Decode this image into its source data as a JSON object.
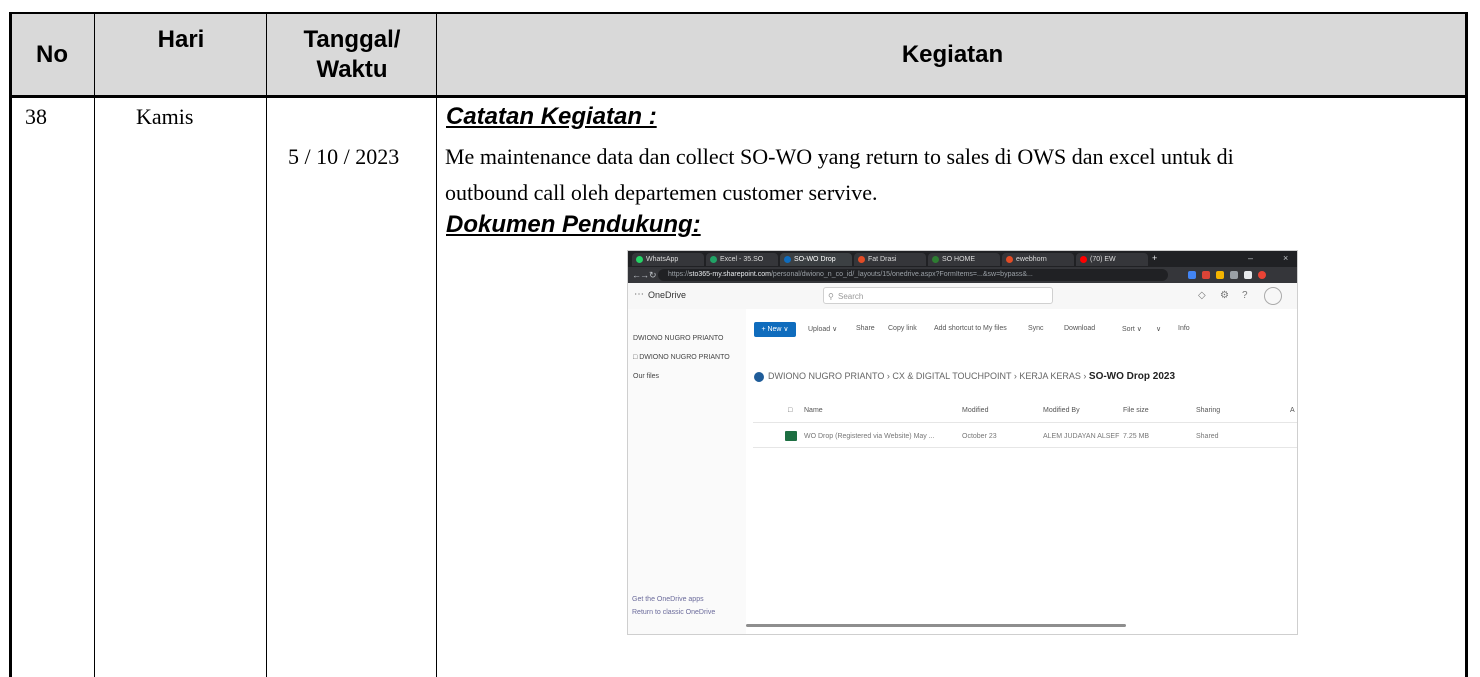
{
  "table": {
    "headers": {
      "no": "No",
      "hari": "Hari",
      "tanggal_line1": "Tanggal/",
      "tanggal_line2": "Waktu",
      "kegiatan": "Kegiatan"
    },
    "row": {
      "no": "38",
      "hari": "Kamis",
      "tanggal": "5 / 10 / 2023",
      "catatan_title": "Catatan Kegiatan :",
      "catatan_line1": "Me maintenance data dan collect SO-WO yang return to sales di OWS dan excel untuk  di",
      "catatan_line2": "outbound call oleh departemen customer servive.",
      "dokumen_title": "Dokumen Pendukung:"
    },
    "header_bg": "#d9d9d9"
  },
  "screenshot": {
    "tabs": [
      {
        "label": "WhatsApp",
        "icon": "whatsapp-icon",
        "color": "#25d366"
      },
      {
        "label": "Excel - 35.SO",
        "icon": "excel-icon",
        "color": "#21a366"
      },
      {
        "label": "SO-WO Drop",
        "icon": "onedrive-icon",
        "color": "#0f6cbd",
        "active": true
      },
      {
        "label": "Fat Drasi",
        "icon": "app-icon",
        "color": "#e34c26"
      },
      {
        "label": "SO HOME",
        "icon": "app-icon",
        "color": "#2e7d32"
      },
      {
        "label": "ewebhorn",
        "icon": "app-icon",
        "color": "#e34c26"
      },
      {
        "label": "(70) EW",
        "icon": "youtube-icon",
        "color": "#ff0000"
      }
    ],
    "url_prefix": "https://",
    "url_host": "sto365-my.sharepoint.com",
    "url_rest": "/personal/dwiono_n_co_id/_layouts/15/onedrive.aspx?FormItems=...&sw=bypass&...",
    "app_name": "OneDrive",
    "search_placeholder": "Search",
    "nav": {
      "user": "DWIONO NUGRO PRIANTO",
      "folder": "DWIONO NUGRO PRIANTO",
      "our_files": "Our files",
      "get_apps": "Get the OneDrive apps",
      "return_classic": "Return to classic OneDrive"
    },
    "commands": {
      "new": "+ New ∨",
      "upload": "Upload ∨",
      "share": "Share",
      "copy_link": "Copy link",
      "add_shortcut": "Add shortcut to My files",
      "sync": "Sync",
      "download": "Download",
      "sort": "Sort ∨",
      "view": "∨",
      "info": "Info"
    },
    "breadcrumb": {
      "p1": "DWIONO NUGRO PRIANTO",
      "p2": "CX & DIGITAL TOUCHPOINT",
      "p3": "KERJA KERAS",
      "current": "SO-WO Drop 2023"
    },
    "columns": [
      "Name",
      "Modified",
      "Modified By",
      "File size",
      "Sharing",
      "A"
    ],
    "file_row": {
      "name": "WO Drop (Registered via Website) May ...",
      "modified": "October 23",
      "modified_by": "ALEM JUDAYAN ALSEF",
      "size": "7.25 MB",
      "sharing": "Shared"
    }
  }
}
